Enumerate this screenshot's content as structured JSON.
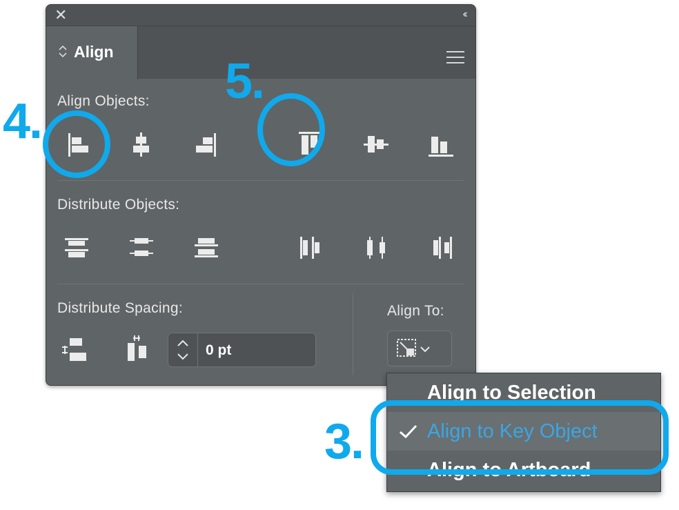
{
  "panel": {
    "tab_label": "Align",
    "align_objects_label": "Align Objects:",
    "distribute_objects_label": "Distribute Objects:",
    "distribute_spacing_label": "Distribute Spacing:",
    "align_to_label": "Align To:",
    "spacing_value": "0 pt"
  },
  "dropdown": {
    "items": [
      {
        "label": "Align to Selection",
        "checked": false
      },
      {
        "label": "Align to Key Object",
        "checked": true
      },
      {
        "label": "Align to Artboard",
        "checked": false
      }
    ]
  },
  "annotations": {
    "step_3": "3.",
    "step_4": "4.",
    "step_5": "5."
  },
  "colors": {
    "panel_bg": "#5f6466",
    "accent": "#10a9ec",
    "highlight_text": "#38a7e7"
  }
}
